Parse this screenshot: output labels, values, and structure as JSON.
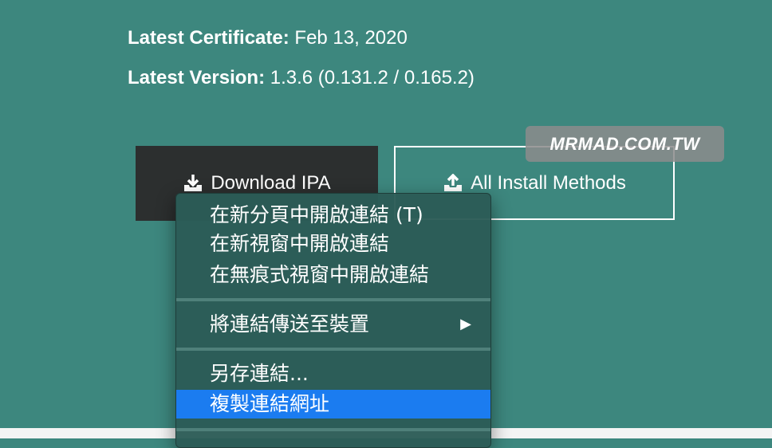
{
  "info": {
    "cert_key": "Latest Certificate:",
    "cert_val": "Feb 13, 2020",
    "version_key": "Latest Version:",
    "version_val": "1.3.6 (0.131.2 / 0.165.2)"
  },
  "watermark": "MRMAD.COM.TW",
  "buttons": {
    "download": {
      "label": "Download IPA",
      "icon": "download-tray-icon"
    },
    "install": {
      "label": "All Install Methods",
      "icon": "upload-tray-icon"
    }
  },
  "context_menu": {
    "open_new_tab": "在新分頁中開啟連結 (T)",
    "open_new_window": "在新視窗中開啟連結",
    "open_incognito": "在無痕式視窗中開啟連結",
    "send_to_device": "將連結傳送至裝置",
    "send_arrow": "▶",
    "save_link": "另存連結...",
    "copy_link": "複製連結網址"
  },
  "colors": {
    "page_bg": "#3d877e",
    "download_bg": "#2c2f2f",
    "menu_bg": "#2c5c56",
    "highlight": "#1b7cf0"
  }
}
